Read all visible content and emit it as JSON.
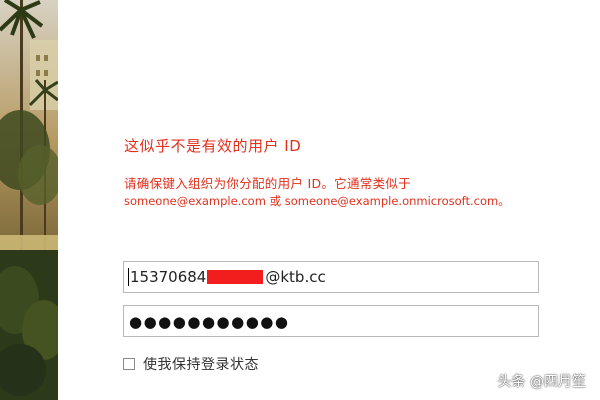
{
  "error": {
    "title": "这似乎不是有效的用户 ID",
    "description": "请确保键入组织为你分配的用户 ID。它通常类似于",
    "examples": "someone@example.com 或 someone@example.onmicrosoft.com。"
  },
  "login": {
    "username_prefix": "15370684",
    "username_suffix": "@ktb.cc",
    "password_mask": "●●●●●●●●●●●",
    "keep_signed_in_label": "使我保持登录状态",
    "keep_signed_in_checked": false
  },
  "watermark": {
    "text": "头条 @四月笙"
  },
  "colors": {
    "error_text": "#e0311d",
    "redaction": "#f21d1d",
    "field_border": "#b9b9b9"
  }
}
